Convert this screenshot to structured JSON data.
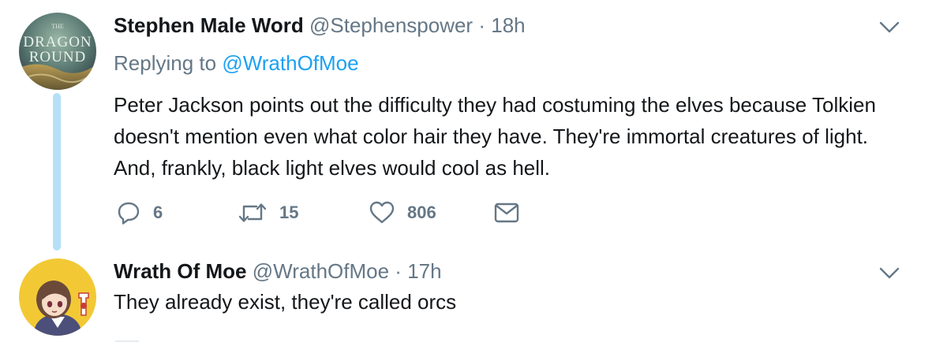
{
  "tweets": [
    {
      "display_name": "Stephen Male Word",
      "handle": "@Stephenspower",
      "separator": "·",
      "time": "18h",
      "replying_prefix": "Replying to",
      "replying_to": "@WrathOfMoe",
      "text": "Peter Jackson points out the difficulty they had costuming the elves because Tolkien doesn't mention even what color hair they have. They're immortal creatures of light. And, frankly, black light elves would cool as hell.",
      "avatar_text_line1": "DRAGON",
      "avatar_text_line2": "ROUND",
      "avatar_text_top": "THE",
      "reply_count": "6",
      "retweet_count": "15",
      "like_count": "806",
      "icons": {
        "reply": "reply-icon",
        "retweet": "retweet-icon",
        "like": "heart-icon",
        "dm": "envelope-icon",
        "menu": "chevron-down-icon"
      }
    },
    {
      "display_name": "Wrath Of Moe",
      "handle": "@WrathOfMoe",
      "separator": "·",
      "time": "17h",
      "text": "They already exist, they're called orcs"
    }
  ],
  "colors": {
    "link": "#1da1f2",
    "secondary_text": "#657786",
    "thread_line": "#b6e0f7",
    "avatar2_bg": "#f2c935"
  }
}
